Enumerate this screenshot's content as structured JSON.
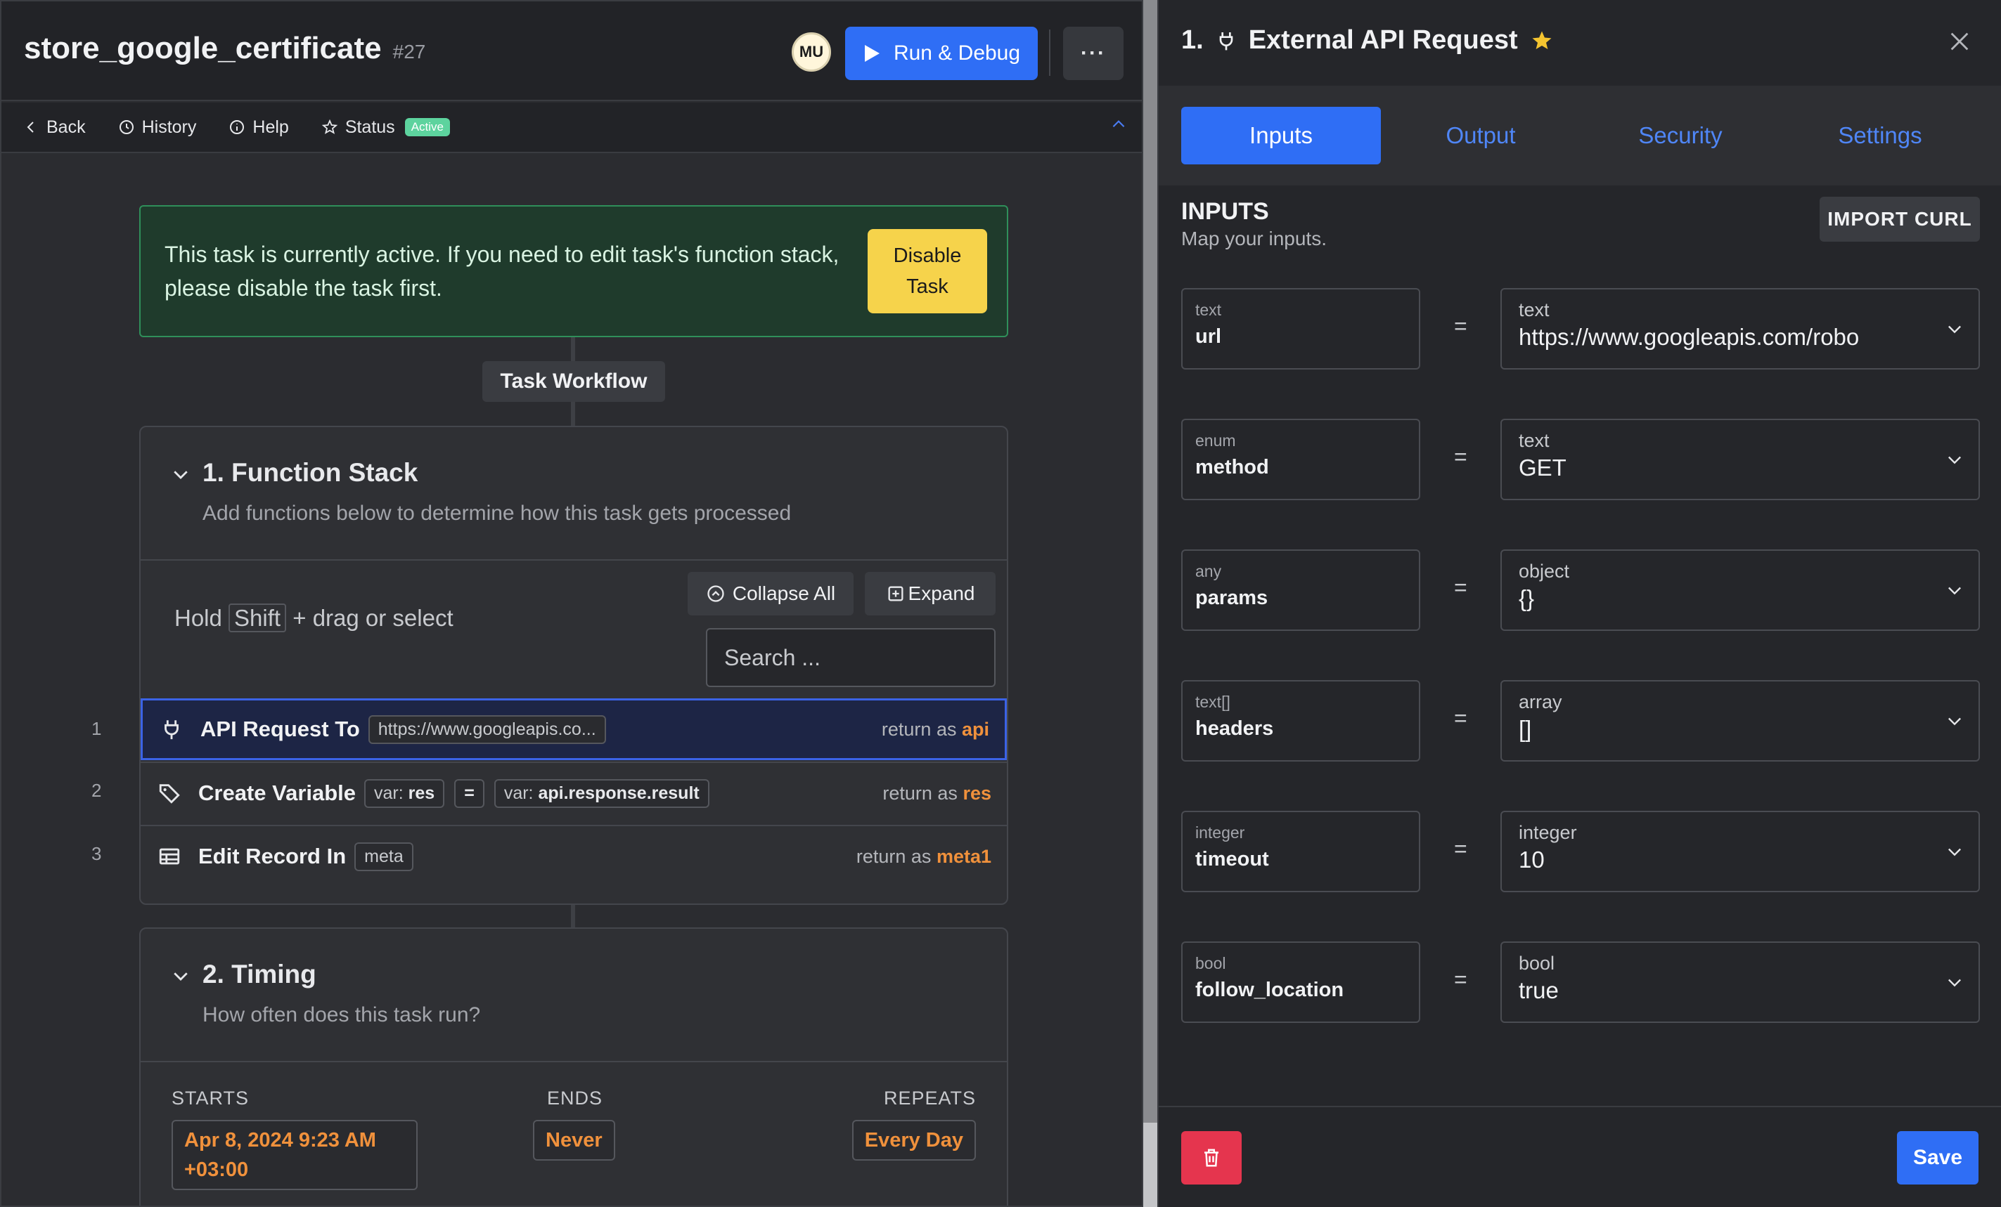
{
  "header": {
    "title": "store_google_certificate",
    "task_id": "#27",
    "avatar_initials": "MU",
    "run_label": "Run & Debug",
    "more_label": "···"
  },
  "nav": {
    "back": "Back",
    "history": "History",
    "help": "Help",
    "status": "Status",
    "status_badge": "Active"
  },
  "alert": {
    "text": "This task is currently active. If you need to edit task's function stack, please disable the task first.",
    "button_line1": "Disable",
    "button_line2": "Task"
  },
  "workflow_label": "Task Workflow",
  "function_stack": {
    "title": "1. Function Stack",
    "subtitle": "Add functions below to determine how this task gets processed",
    "hint_pre": "Hold",
    "hint_key": "Shift",
    "hint_post": "+ drag or select",
    "collapse_all": "Collapse All",
    "expand": "Expand",
    "search_placeholder": "Search ...",
    "rows": [
      {
        "num": "1",
        "name": "API Request To",
        "chip": "https://www.googleapis.co...",
        "ret_label": "return as",
        "ret_var": "api"
      },
      {
        "num": "2",
        "name": "Create Variable",
        "chip_a_pre": "var:",
        "chip_a": "res",
        "chip_eq": "=",
        "chip_b_pre": "var:",
        "chip_b": "api.response.result",
        "ret_label": "return as",
        "ret_var": "res"
      },
      {
        "num": "3",
        "name": "Edit Record In",
        "chip": "meta",
        "ret_label": "return as",
        "ret_var": "meta1"
      }
    ]
  },
  "timing": {
    "title": "2. Timing",
    "subtitle": "How often does this task run?",
    "starts_label": "STARTS",
    "starts_line1": "Apr 8, 2024 9:23 AM",
    "starts_line2": "+03:00",
    "ends_label": "ENDS",
    "ends_value": "Never",
    "repeats_label": "REPEATS",
    "repeats_value": "Every Day"
  },
  "panel": {
    "title": "1.",
    "name": "External API Request",
    "tabs": [
      "Inputs",
      "Output",
      "Security",
      "Settings"
    ],
    "section_title": "INPUTS",
    "section_sub": "Map your inputs.",
    "import_label": "IMPORT CURL",
    "inputs": [
      {
        "type": "text",
        "name": "url",
        "vtype": "text",
        "value": "https://www.googleapis.com/robo"
      },
      {
        "type": "enum",
        "name": "method",
        "vtype": "text",
        "value": "GET"
      },
      {
        "type": "any",
        "name": "params",
        "vtype": "object",
        "value": "{}"
      },
      {
        "type": "text[]",
        "name": "headers",
        "vtype": "array",
        "value": "[]"
      },
      {
        "type": "integer",
        "name": "timeout",
        "vtype": "integer",
        "value": "10"
      },
      {
        "type": "bool",
        "name": "follow_location",
        "vtype": "bool",
        "value": "true"
      }
    ],
    "eq": "=",
    "save_label": "Save"
  },
  "colors": {
    "accent": "#2f6ef5",
    "return_var": "#f0913c",
    "active_badge": "#5dd39e",
    "alert_bg": "#1f3b2c",
    "disable_btn": "#f6d34b",
    "delete_btn": "#e5354e",
    "star": "#f4c430"
  }
}
